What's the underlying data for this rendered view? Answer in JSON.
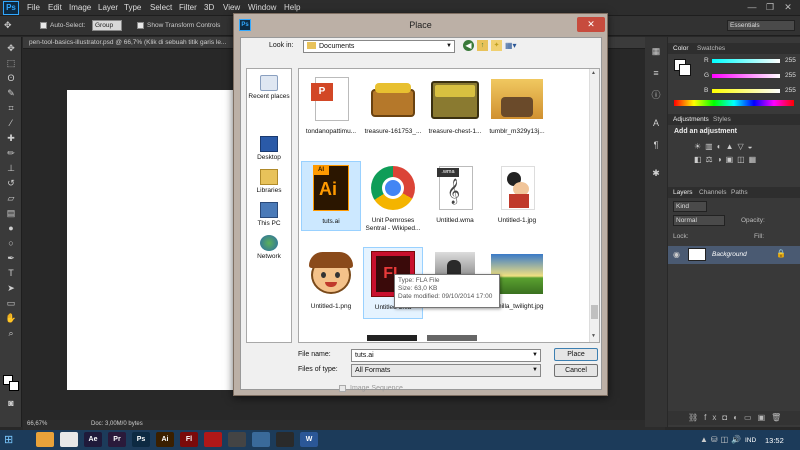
{
  "app": {
    "logo": "Ps"
  },
  "menu": [
    "File",
    "Edit",
    "Image",
    "Layer",
    "Type",
    "Select",
    "Filter",
    "3D",
    "View",
    "Window",
    "Help"
  ],
  "window_controls": {
    "minimize": "—",
    "restore": "❐",
    "close": "✕"
  },
  "options_bar": {
    "auto_select_label": "Auto-Select:",
    "auto_select_value": "Group",
    "show_transform_label": "Show Transform Controls",
    "workspace": "Essentials"
  },
  "document": {
    "tab_title": "pen-tool-basics-illustrator.psd @ 66,7% (Klik di sebuah titik garis le...",
    "zoom": "66,67%",
    "doc_info": "Doc: 3,00M/0 bytes"
  },
  "panels": {
    "color_tab": "Color",
    "swatches_tab": "Swatches",
    "channels": [
      {
        "label": "R",
        "value": "255",
        "color": "#e0405a"
      },
      {
        "label": "G",
        "value": "255",
        "color": "#40b060"
      },
      {
        "label": "B",
        "value": "255",
        "color": "#4070e0"
      }
    ],
    "adjustments_tab": "Adjustments",
    "styles_tab": "Styles",
    "add_adjustment": "Add an adjustment",
    "layers_tab": "Layers",
    "channels_tab": "Channels",
    "paths_tab": "Paths",
    "kind": "Kind",
    "blend_mode": "Normal",
    "opacity_label": "Opacity:",
    "lock_label": "Lock:",
    "fill_label": "Fill:",
    "layer_name": "Background"
  },
  "dialog": {
    "title": "Place",
    "look_in_label": "Look in:",
    "look_in_value": "Documents",
    "places": [
      {
        "label": "Recent places",
        "icon": "recent-places-icon"
      },
      {
        "label": "Desktop",
        "icon": "desktop-icon"
      },
      {
        "label": "Libraries",
        "icon": "libraries-icon"
      },
      {
        "label": "This PC",
        "icon": "this-pc-icon"
      },
      {
        "label": "Network",
        "icon": "network-icon"
      }
    ],
    "files": [
      {
        "name": "tondanopattimu...",
        "kind": "ppt"
      },
      {
        "name": "treasure-161753_...",
        "kind": "chest"
      },
      {
        "name": "treasure-chest-1...",
        "kind": "chest2"
      },
      {
        "name": "tumblr_m329y13j...",
        "kind": "scene"
      },
      {
        "name": "tuts.ai",
        "kind": "ai",
        "selected": true,
        "badge": "AI"
      },
      {
        "name": "Unit Pemroses Sentral - Wikiped...",
        "kind": "chrome"
      },
      {
        "name": "Untitled.wma",
        "kind": "wma",
        "badge": ".wma"
      },
      {
        "name": "Untitled-1.jpg",
        "kind": "cartoon"
      },
      {
        "name": "Untitled-1.png",
        "kind": "face"
      },
      {
        "name": "Untitled-2.fla",
        "kind": "fla",
        "badge": "FL"
      },
      {
        "name": "...",
        "kind": "dark"
      },
      {
        "name": "Vanilla_twilight.jpg",
        "kind": "landscape"
      }
    ],
    "tooltip": {
      "type": "Type: FLA File",
      "size": "Size: 63,0 KB",
      "modified": "Date modified: 09/10/2014 17:00"
    },
    "file_name_label": "File name:",
    "file_name_value": "tuts.ai",
    "file_type_label": "Files of type:",
    "file_type_value": "All Formats",
    "image_sequence_label": "Image Sequence",
    "place_button": "Place",
    "cancel_button": "Cancel"
  },
  "taskbar": {
    "apps": [
      {
        "label": "",
        "color": "#e8a23a",
        "icon": "folder-icon"
      },
      {
        "label": "",
        "color": "#e8e8e8",
        "icon": "chrome-icon"
      },
      {
        "label": "Ae",
        "color": "#1f1a3a",
        "icon": "after-effects-icon"
      },
      {
        "label": "Pr",
        "color": "#2a1a3a",
        "icon": "premiere-icon"
      },
      {
        "label": "Ps",
        "color": "#0d2a42",
        "icon": "photoshop-icon"
      },
      {
        "label": "Ai",
        "color": "#3a1f00",
        "icon": "illustrator-icon"
      },
      {
        "label": "Fl",
        "color": "#7a0a0a",
        "icon": "flash-icon"
      },
      {
        "label": "",
        "color": "#b01818",
        "icon": "red-app-icon"
      },
      {
        "label": "",
        "color": "#444444",
        "icon": "disc-icon"
      },
      {
        "label": "",
        "color": "#3a6a9a",
        "icon": "steam-icon"
      },
      {
        "label": "",
        "color": "#2a2a2a",
        "icon": "media-icon"
      },
      {
        "label": "",
        "color": "#222222",
        "icon": "app-icon"
      },
      {
        "label": "W",
        "color": "#2b5797",
        "icon": "word-icon"
      }
    ],
    "lang": "IND",
    "time": "13:52"
  }
}
